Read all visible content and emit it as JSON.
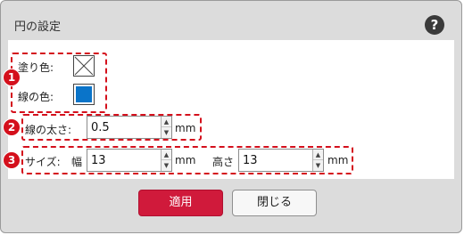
{
  "dialog": {
    "title": "円の設定",
    "help_glyph": "?"
  },
  "fill": {
    "badge": "1",
    "label": "塗り色:",
    "value": "none"
  },
  "stroke": {
    "label": "線の色:",
    "color": "#0a74c9"
  },
  "width": {
    "badge": "2",
    "label": "線の太さ:",
    "value": "0.5",
    "unit": "mm"
  },
  "size": {
    "badge": "3",
    "label": "サイズ:",
    "width_label": "幅",
    "width_value": "13",
    "width_unit": "mm",
    "height_label": "高さ",
    "height_value": "13",
    "height_unit": "mm"
  },
  "footer": {
    "apply_label": "適用",
    "close_label": "閉じる"
  },
  "icons": {
    "help": "help-icon",
    "spin_up": "up-arrow-icon",
    "spin_down": "down-arrow-icon",
    "no_color": "no-color-icon"
  },
  "colors": {
    "accent": "#d01a3b",
    "marker": "#d4101c"
  }
}
